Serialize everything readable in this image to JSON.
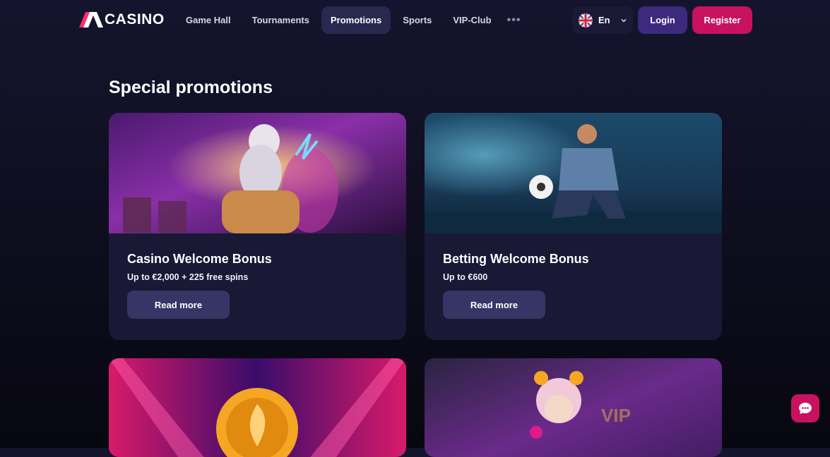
{
  "header": {
    "logo_text": "CASINO",
    "nav": [
      {
        "label": "Game Hall",
        "active": false
      },
      {
        "label": "Tournaments",
        "active": false
      },
      {
        "label": "Promotions",
        "active": true
      },
      {
        "label": "Sports",
        "active": false
      },
      {
        "label": "VIP-Club",
        "active": false
      }
    ],
    "more_icon": "more-dots-icon",
    "language": {
      "label": "En",
      "flag_icon": "uk-flag-icon"
    },
    "login_label": "Login",
    "register_label": "Register"
  },
  "main": {
    "title": "Special promotions",
    "promotions": [
      {
        "title": "Casino Welcome Bonus",
        "subtitle": "Up to €2,000 + 225 free spins",
        "button": "Read more"
      },
      {
        "title": "Betting Welcome Bonus",
        "subtitle": "Up to €600",
        "button": "Read more"
      },
      {
        "title": "",
        "subtitle": "",
        "button": ""
      },
      {
        "title": "",
        "subtitle": "",
        "button": ""
      }
    ]
  },
  "chat": {
    "icon": "chat-bubble-icon"
  },
  "colors": {
    "background": "#100f22",
    "card": "#191835",
    "nav_active": "#29284f",
    "login": "#3d2a7e",
    "register": "#c8125f",
    "read_more": "#363566"
  }
}
